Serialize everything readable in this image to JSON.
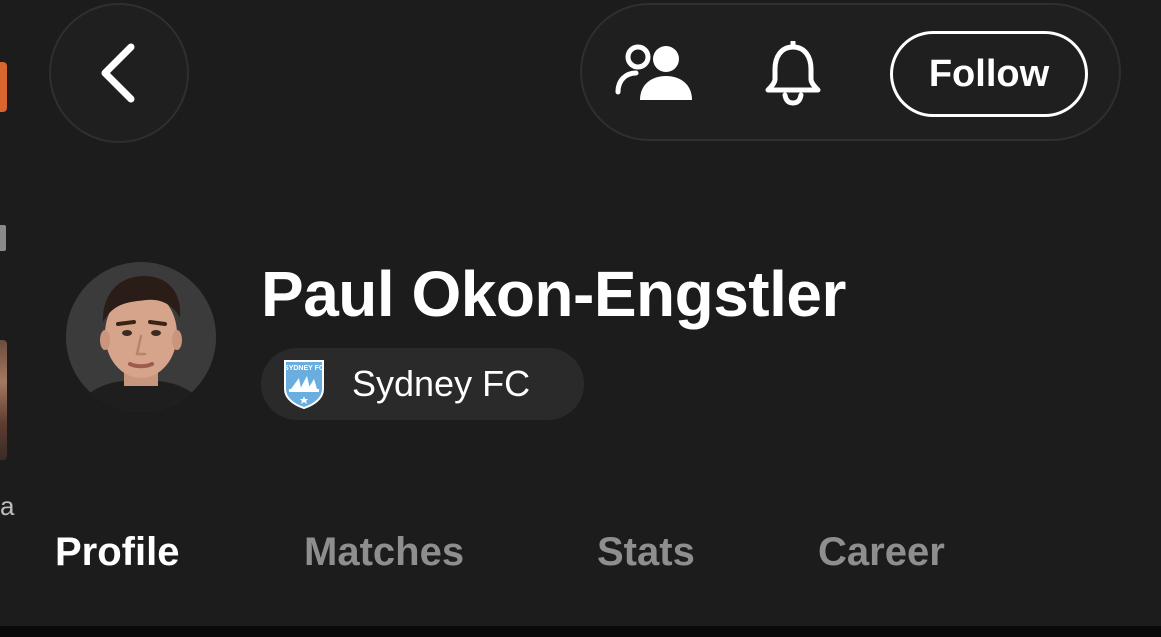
{
  "header": {
    "back_icon": "chevron-left-icon",
    "actions": {
      "friends_icon": "people-icon",
      "notifications_icon": "bell-icon",
      "follow_label": "Follow"
    }
  },
  "player": {
    "name": "Paul Okon-Engstler",
    "avatar_icon": "player-photo",
    "club": {
      "name": "Sydney FC",
      "crest_text": "SYDNEY FC",
      "crest_color": "#6aaee0"
    }
  },
  "tabs": [
    {
      "label": "Profile",
      "active": true
    },
    {
      "label": "Matches",
      "active": false
    },
    {
      "label": "Stats",
      "active": false
    },
    {
      "label": "Career",
      "active": false
    }
  ],
  "left_peek": {
    "text": "a"
  },
  "colors": {
    "background": "#1c1c1c",
    "active_tab": "#ffffff",
    "inactive_tab": "#8e8e8e",
    "chip_background": "#2a2a2a",
    "accent_orange": "#d8662e"
  }
}
